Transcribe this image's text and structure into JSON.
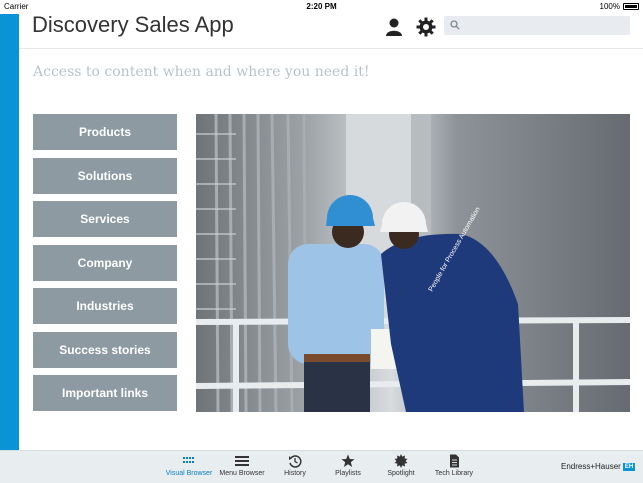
{
  "status_bar": {
    "carrier": "Carrier",
    "time": "2:20 PM",
    "battery": "100%"
  },
  "header": {
    "title": "Discovery Sales App",
    "search_placeholder": "",
    "icons": [
      "user-icon",
      "gear-icon",
      "search-icon"
    ]
  },
  "tagline": "Access to content when and where you need it!",
  "nav": {
    "items": [
      {
        "label": "Products"
      },
      {
        "label": "Solutions"
      },
      {
        "label": "Services"
      },
      {
        "label": "Company"
      },
      {
        "label": "Industries"
      },
      {
        "label": "Success stories"
      },
      {
        "label": "Important links"
      }
    ]
  },
  "hero": {
    "jacket_text": "People for Process Automation"
  },
  "tab_bar": {
    "tabs": [
      {
        "label": "Visual Browser",
        "icon": "grid-dots-icon",
        "active": true
      },
      {
        "label": "Menu Browser",
        "icon": "menu-icon",
        "active": false
      },
      {
        "label": "History",
        "icon": "history-icon",
        "active": false
      },
      {
        "label": "Playlists",
        "icon": "star-icon",
        "active": false
      },
      {
        "label": "Spotlight",
        "icon": "burst-icon",
        "active": false
      },
      {
        "label": "Tech Library",
        "icon": "document-icon",
        "active": false
      }
    ],
    "brand": "Endress+Hauser",
    "brand_badge": "EH"
  },
  "colors": {
    "accent": "#0a94d6",
    "nav_button": "#8d9aa1",
    "tagline": "#b8c4cc",
    "tab_bar": "#e8edf0"
  }
}
